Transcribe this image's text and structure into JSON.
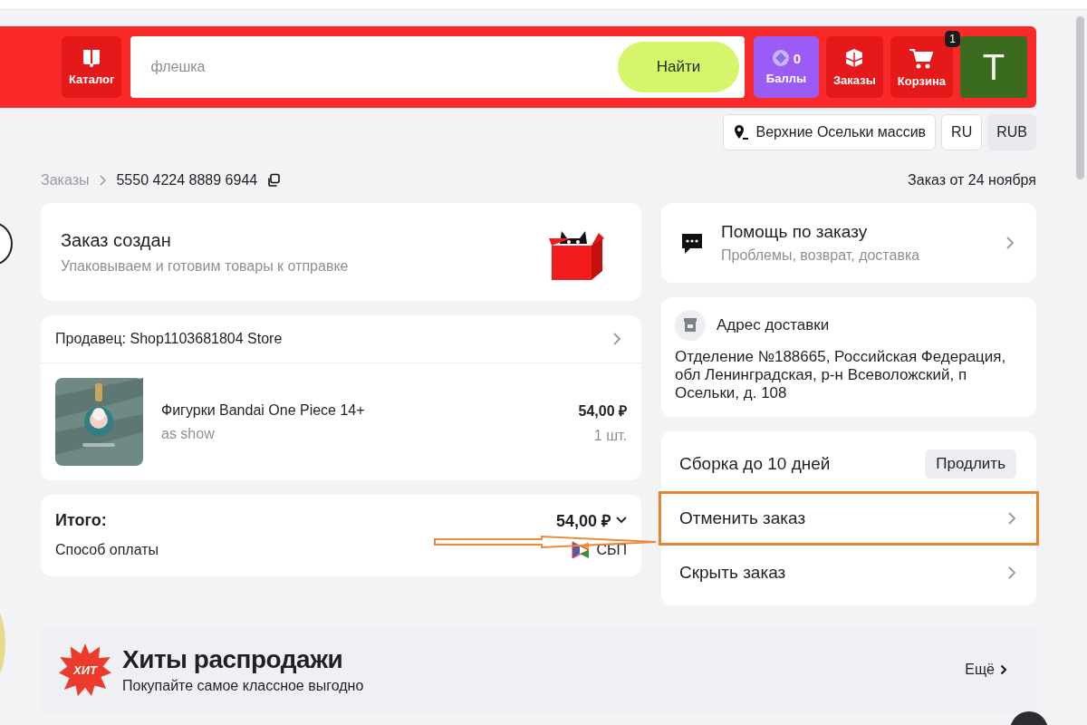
{
  "header": {
    "catalog": "Каталог",
    "search": {
      "placeholder": "флешка"
    },
    "search_button": "Найти",
    "points": {
      "count": "0",
      "label": "Баллы"
    },
    "orders": "Заказы",
    "cart": {
      "label": "Корзина",
      "badge": "1"
    },
    "avatar": "T"
  },
  "location": {
    "address": "Верхние Осельки массив",
    "language": "RU",
    "currency": "RUB"
  },
  "breadcrumbs": {
    "parent": "Заказы",
    "order_number": "5550 4224 8889 6944",
    "order_date": "Заказ от 24 ноября"
  },
  "status": {
    "title": "Заказ создан",
    "subtitle": "Упаковываем и готовим товары к отправке"
  },
  "seller": {
    "label": "Продавец: Shop1103681804 Store"
  },
  "items": [
    {
      "name": "Фигурки Bandai One Piece 14+",
      "variant": "as show",
      "price": "54,00 ₽",
      "quantity": "1 шт."
    }
  ],
  "summary": {
    "total_label": "Итого:",
    "total": "54,00 ₽",
    "payment_label": "Способ оплаты",
    "payment_method": "СБП"
  },
  "help": {
    "title": "Помощь по заказу",
    "subtitle": "Проблемы, возврат, доставка"
  },
  "delivery": {
    "title": "Адрес доставки",
    "address": "Отделение №188665, Российская Федерация, обл Ленинградская, р-н Всеволожский, п Осельки, д. 108"
  },
  "actions": [
    {
      "kind": "deadline",
      "label": "Сборка до 10 дней",
      "button": "Продлить",
      "annotated": false
    },
    {
      "kind": "link",
      "label": "Отменить заказ",
      "annotated": true
    },
    {
      "kind": "link",
      "label": "Скрыть заказ",
      "annotated": false
    }
  ],
  "promo": {
    "badge": "ХИТ",
    "title": "Хиты распродажи",
    "subtitle": "Покупайте самое классное выгодно",
    "more": "Ещё"
  }
}
